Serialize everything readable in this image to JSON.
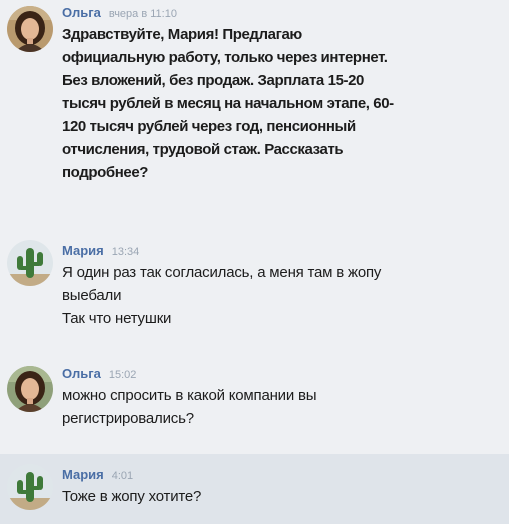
{
  "messages": [
    {
      "author": "Ольга",
      "time": "вчера в 11:10",
      "avatar_icon": "woman-portrait-avatar",
      "lines": [
        "Здравствуйте, Мария! Предлагаю",
        "официальную работу, только через интернет.",
        "Без вложений, без продаж. Зарплата 15-20",
        "тысяч рублей в месяц на начальном этапе, 60-",
        "120 тысяч рублей через год, пенсионный",
        "отчисления, трудовой стаж. Рассказать",
        "подробнее?"
      ]
    },
    {
      "author": "Мария",
      "time": "13:34",
      "avatar_icon": "cactus-avatar",
      "lines": [
        "Я один раз так согласилась, а меня там в жопу",
        "выебали",
        "Так что нетушки"
      ]
    },
    {
      "author": "Ольга",
      "time": "15:02",
      "avatar_icon": "woman-portrait-avatar",
      "lines": [
        "можно спросить в какой компании вы",
        "регистрировались?"
      ]
    },
    {
      "author": "Мария",
      "time": "4:01",
      "avatar_icon": "cactus-avatar",
      "lines": [
        "Тоже в жопу хотите?"
      ]
    }
  ]
}
